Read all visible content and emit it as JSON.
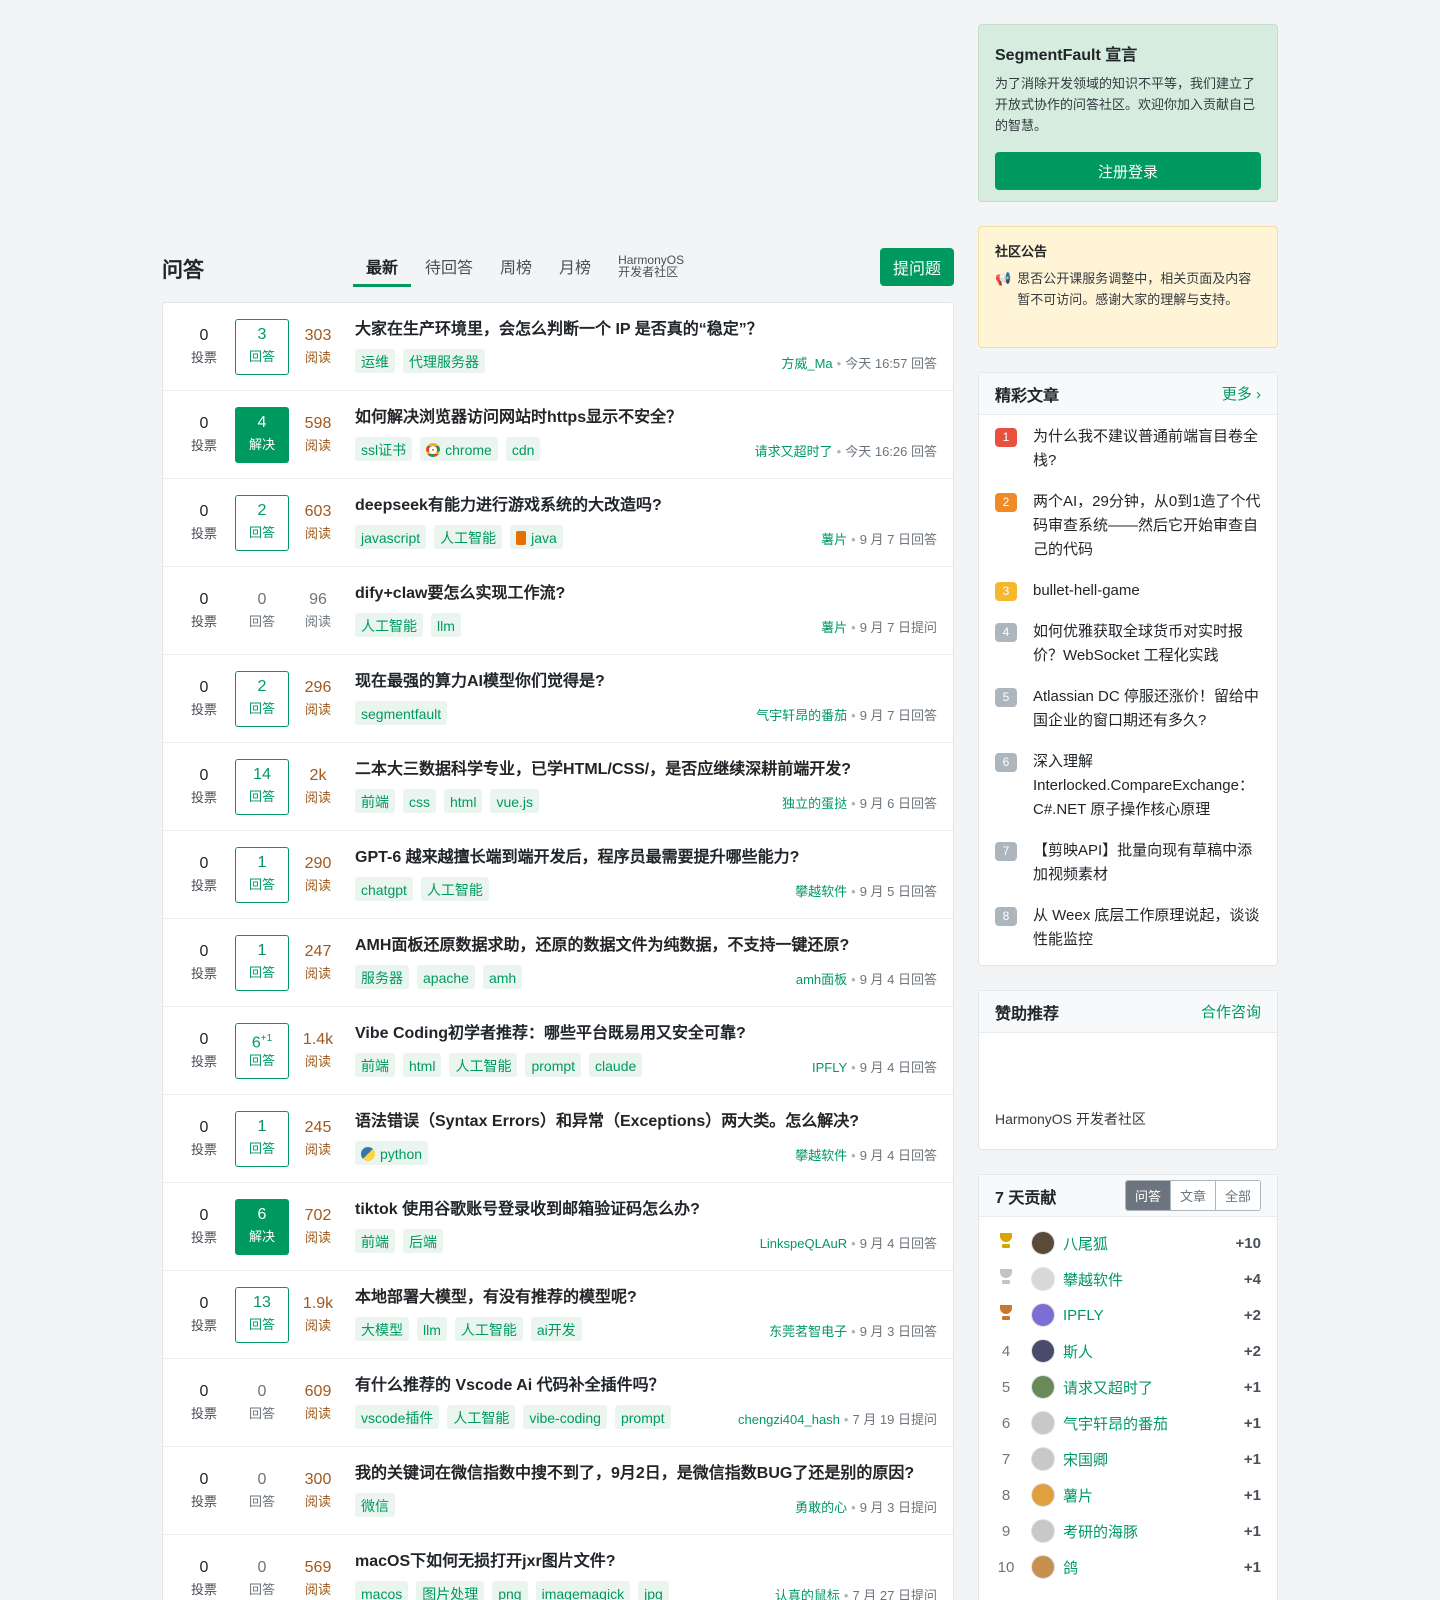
{
  "qa": {
    "title": "问答",
    "tabs": [
      "最新",
      "待回答",
      "周榜",
      "月榜"
    ],
    "harmony_tab": [
      "HarmonyOS",
      "开发者社区"
    ],
    "ask_label": "提问题"
  },
  "questions": [
    {
      "votes": "0",
      "votes_label": "投票",
      "answers": "3",
      "answers_label": "回答",
      "answer_style": "bordered",
      "views": "303",
      "views_label": "阅读",
      "title": "大家在生产环境里，会怎么判断一个 IP 是否真的“稳定”？",
      "tags": [
        "运维",
        "代理服务器"
      ],
      "author": "方威_Ma",
      "time": "今天 16:57 回答"
    },
    {
      "votes": "0",
      "votes_label": "投票",
      "answers": "4",
      "answers_label": "解决",
      "answer_style": "solved",
      "views": "598",
      "views_label": "阅读",
      "title": "如何解决浏览器访问网站时https显示不安全？",
      "tags": [
        "ssl证书",
        "chrome",
        "cdn"
      ],
      "author": "请求又超时了",
      "time": "今天 16:26 回答"
    },
    {
      "votes": "0",
      "votes_label": "投票",
      "answers": "2",
      "answers_label": "回答",
      "answer_style": "bordered",
      "views": "603",
      "views_label": "阅读",
      "title": "deepseek有能力进行游戏系统的大改造吗?",
      "tags": [
        "javascript",
        "人工智能",
        "java"
      ],
      "author": "薯片",
      "time": "9 月 7 日回答"
    },
    {
      "votes": "0",
      "votes_label": "投票",
      "answers": "0",
      "answers_label": "回答",
      "answer_style": "plain",
      "views": "96",
      "views_label": "阅读",
      "views_muted": true,
      "title": "dify+claw要怎么实现工作流?",
      "tags": [
        "人工智能",
        "llm"
      ],
      "author": "薯片",
      "time": "9 月 7 日提问"
    },
    {
      "votes": "0",
      "votes_label": "投票",
      "answers": "2",
      "answers_label": "回答",
      "answer_style": "bordered",
      "views": "296",
      "views_label": "阅读",
      "title": "现在最强的算力AI模型你们觉得是?",
      "tags": [
        "segmentfault"
      ],
      "author": "气宇轩昂的番茄",
      "time": "9 月 7 日回答"
    },
    {
      "votes": "0",
      "votes_label": "投票",
      "answers": "14",
      "answers_label": "回答",
      "answer_style": "bordered",
      "views": "2k",
      "views_label": "阅读",
      "title": "二本大三数据科学专业，已学HTML/CSS/，是否应继续深耕前端开发?",
      "tags": [
        "前端",
        "css",
        "html",
        "vue.js"
      ],
      "author": "独立的蛋挞",
      "time": "9 月 6 日回答"
    },
    {
      "votes": "0",
      "votes_label": "投票",
      "answers": "1",
      "answers_label": "回答",
      "answer_style": "bordered",
      "views": "290",
      "views_label": "阅读",
      "title": "GPT-6 越来越擅长端到端开发后，程序员最需要提升哪些能力?",
      "tags": [
        "chatgpt",
        "人工智能"
      ],
      "author": "攀越软件",
      "time": "9 月 5 日回答"
    },
    {
      "votes": "0",
      "votes_label": "投票",
      "answers": "1",
      "answers_label": "回答",
      "answer_style": "bordered",
      "views": "247",
      "views_label": "阅读",
      "title": "AMH面板还原数据求助，还原的数据文件为纯数据，不支持一键还原?",
      "tags": [
        "服务器",
        "apache",
        "amh"
      ],
      "author": "amh面板",
      "time": "9 月 4 日回答"
    },
    {
      "votes": "0",
      "votes_label": "投票",
      "answers": "6",
      "answers_sup": "+1",
      "answers_label": "回答",
      "answer_style": "bordered",
      "views": "1.4k",
      "views_label": "阅读",
      "title": "Vibe Coding初学者推荐：哪些平台既易用又安全可靠?",
      "tags": [
        "前端",
        "html",
        "人工智能",
        "prompt",
        "claude"
      ],
      "author": "IPFLY",
      "time": "9 月 4 日回答"
    },
    {
      "votes": "0",
      "votes_label": "投票",
      "answers": "1",
      "answers_label": "回答",
      "answer_style": "bordered",
      "views": "245",
      "views_label": "阅读",
      "title": "语法错误（Syntax Errors）和异常（Exceptions）两大类。怎么解决?",
      "tags": [
        "python"
      ],
      "author": "攀越软件",
      "time": "9 月 4 日回答"
    },
    {
      "votes": "0",
      "votes_label": "投票",
      "answers": "6",
      "answers_label": "解决",
      "answer_style": "solved",
      "views": "702",
      "views_label": "阅读",
      "title": "tiktok 使用谷歌账号登录收到邮箱验证码怎么办?",
      "tags": [
        "前端",
        "后端"
      ],
      "author": "LinkspeQLAuR",
      "time": "9 月 4 日回答"
    },
    {
      "votes": "0",
      "votes_label": "投票",
      "answers": "13",
      "answers_label": "回答",
      "answer_style": "bordered",
      "views": "1.9k",
      "views_label": "阅读",
      "title": "本地部署大模型，有没有推荐的模型呢?",
      "tags": [
        "大模型",
        "llm",
        "人工智能",
        "ai开发"
      ],
      "author": "东莞茗智电子",
      "time": "9 月 3 日回答"
    },
    {
      "votes": "0",
      "votes_label": "投票",
      "answers": "0",
      "answers_label": "回答",
      "answer_style": "plain",
      "views": "609",
      "views_label": "阅读",
      "title": "有什么推荐的 Vscode Ai 代码补全插件吗？",
      "tags": [
        "vscode插件",
        "人工智能",
        "vibe-coding",
        "prompt"
      ],
      "author": "chengzi404_hash",
      "time": "7 月 19 日提问"
    },
    {
      "votes": "0",
      "votes_label": "投票",
      "answers": "0",
      "answers_label": "回答",
      "answer_style": "plain",
      "views": "300",
      "views_label": "阅读",
      "title": "我的关键词在微信指数中搜不到了，9月2日，是微信指数BUG了还是别的原因?",
      "tags": [
        "微信"
      ],
      "author": "勇敢的心",
      "time": "9 月 3 日提问"
    },
    {
      "votes": "0",
      "votes_label": "投票",
      "answers": "0",
      "answers_label": "回答",
      "answer_style": "plain",
      "views": "569",
      "views_label": "阅读",
      "title": "macOS下如何无损打开jxr图片文件?",
      "tags": [
        "macos",
        "图片处理",
        "png",
        "imagemagick",
        "jpg"
      ],
      "author": "认真的鼠标",
      "time": "7 月 27 日提问"
    }
  ],
  "tag_icons": {
    "chrome": "chrome-icon",
    "java": "java-icon",
    "python": "python-icon"
  },
  "manifesto": {
    "title": "SegmentFault 宣言",
    "text": "为了消除开发领域的知识不平等，我们建立了开放式协作的问答社区。欢迎你加入贡献自己的智慧。",
    "button": "注册登录"
  },
  "notice": {
    "title": "社区公告",
    "text": "思否公开课服务调整中，相关页面及内容暂不可访问。感谢大家的理解与支持。"
  },
  "articles": {
    "title": "精彩文章",
    "more": "更多 ›",
    "items": [
      "为什么我不建议普通前端盲目卷全栈?",
      "两个AI，29分钟，从0到1造了个代码审查系统——然后它开始审查自己的代码",
      "bullet-hell-game",
      "如何优雅获取全球货币对实时报价？WebSocket 工程化实践",
      "Atlassian DC 停服还涨价！留给中国企业的窗口期还有多久?",
      "深入理解 Interlocked.CompareExchange：C#.NET 原子操作核心原理",
      "【剪映API】批量向现有草稿中添加视频素材",
      "从 Weex 底层工作原理说起，谈谈性能监控"
    ]
  },
  "sponsor": {
    "title": "赞助推荐",
    "link": "合作咨询",
    "item": "HarmonyOS 开发者社区"
  },
  "contrib": {
    "title": "7 天贡献",
    "tabs": [
      "问答",
      "文章",
      "全部"
    ],
    "rows": [
      {
        "rank": "1",
        "name": "八尾狐",
        "score": "+10",
        "avatar": "#5a4a3a"
      },
      {
        "rank": "2",
        "name": "攀越软件",
        "score": "+4",
        "avatar": "#d8d8d8"
      },
      {
        "rank": "3",
        "name": "IPFLY",
        "score": "+2",
        "avatar": "#7b6fd6"
      },
      {
        "rank": "4",
        "name": "斯人",
        "score": "+2",
        "avatar": "#4a4a6a"
      },
      {
        "rank": "5",
        "name": "请求又超时了",
        "score": "+1",
        "avatar": "#6a8a5a"
      },
      {
        "rank": "6",
        "name": "气宇轩昂的番茄",
        "score": "+1",
        "avatar": "#c8c8c8"
      },
      {
        "rank": "7",
        "name": "宋国卿",
        "score": "+1",
        "avatar": "#c8c8c8"
      },
      {
        "rank": "8",
        "name": "薯片",
        "score": "+1",
        "avatar": "#e0a040"
      },
      {
        "rank": "9",
        "name": "考研的海豚",
        "score": "+1",
        "avatar": "#c8c8c8"
      },
      {
        "rank": "10",
        "name": "鸽",
        "score": "+1",
        "avatar": "#c89050"
      }
    ]
  }
}
